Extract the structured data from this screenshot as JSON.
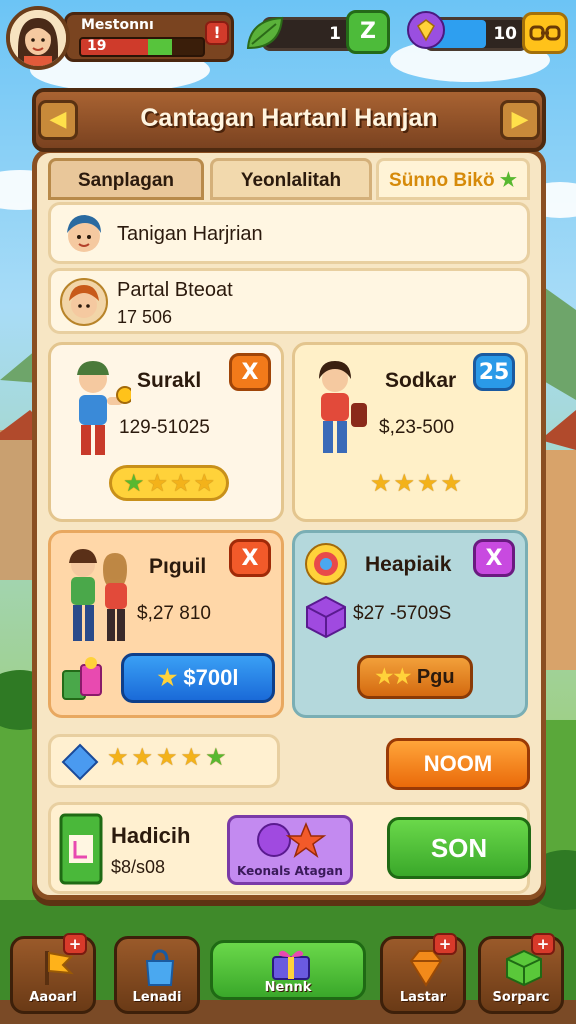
{
  "hud": {
    "player_name": "Mestonnı",
    "level": "19",
    "xp_plus": "!",
    "resource1_value": "1",
    "resource1_plus": "Z",
    "resource2_value": "10",
    "resource2_fill_percent": 60
  },
  "title": "Cantagan Hartanl Hanjan",
  "tabs": [
    {
      "label": "Sanplagan"
    },
    {
      "label": "Yeonlalitah"
    },
    {
      "label": "Sünno Bikö"
    }
  ],
  "rows": {
    "daily": {
      "title": "Tanigan Harjrian"
    },
    "event": {
      "title": "Partal Bteoat",
      "value": "17 506"
    }
  },
  "cards": [
    {
      "title": "Surakl",
      "value": "129-51025",
      "badge": "X",
      "stars": 4
    },
    {
      "title": "Sodkar",
      "value": "$,23-500",
      "badge": "25",
      "stars": 4
    },
    {
      "title": "Pıguil",
      "value": "$,27 810",
      "badge": "X",
      "button": "$700l"
    },
    {
      "title": "Heapiaik",
      "value": "$27 -5709S",
      "badge": "X",
      "button": "Pgu"
    }
  ],
  "stars_row": {
    "count": 5,
    "button": "NOOM"
  },
  "footer": {
    "title": "Hadicih",
    "value": "$8/s08",
    "promo_label": "Keonals Atagan",
    "button": "SON"
  },
  "bottom_nav": [
    {
      "label": "Aaoarl",
      "icon": "flag-icon"
    },
    {
      "label": "Lenadi",
      "icon": "bag-icon"
    },
    {
      "label": "Nennk",
      "icon": "gift-icon"
    },
    {
      "label": "Lastar",
      "icon": "gem-icon"
    },
    {
      "label": "Sorparc",
      "icon": "cube-icon"
    }
  ],
  "colors": {
    "wood": "#8a4f22",
    "green_button": "#4fb82b",
    "orange_button": "#f28a1a",
    "blue_button": "#1f7ee0"
  }
}
